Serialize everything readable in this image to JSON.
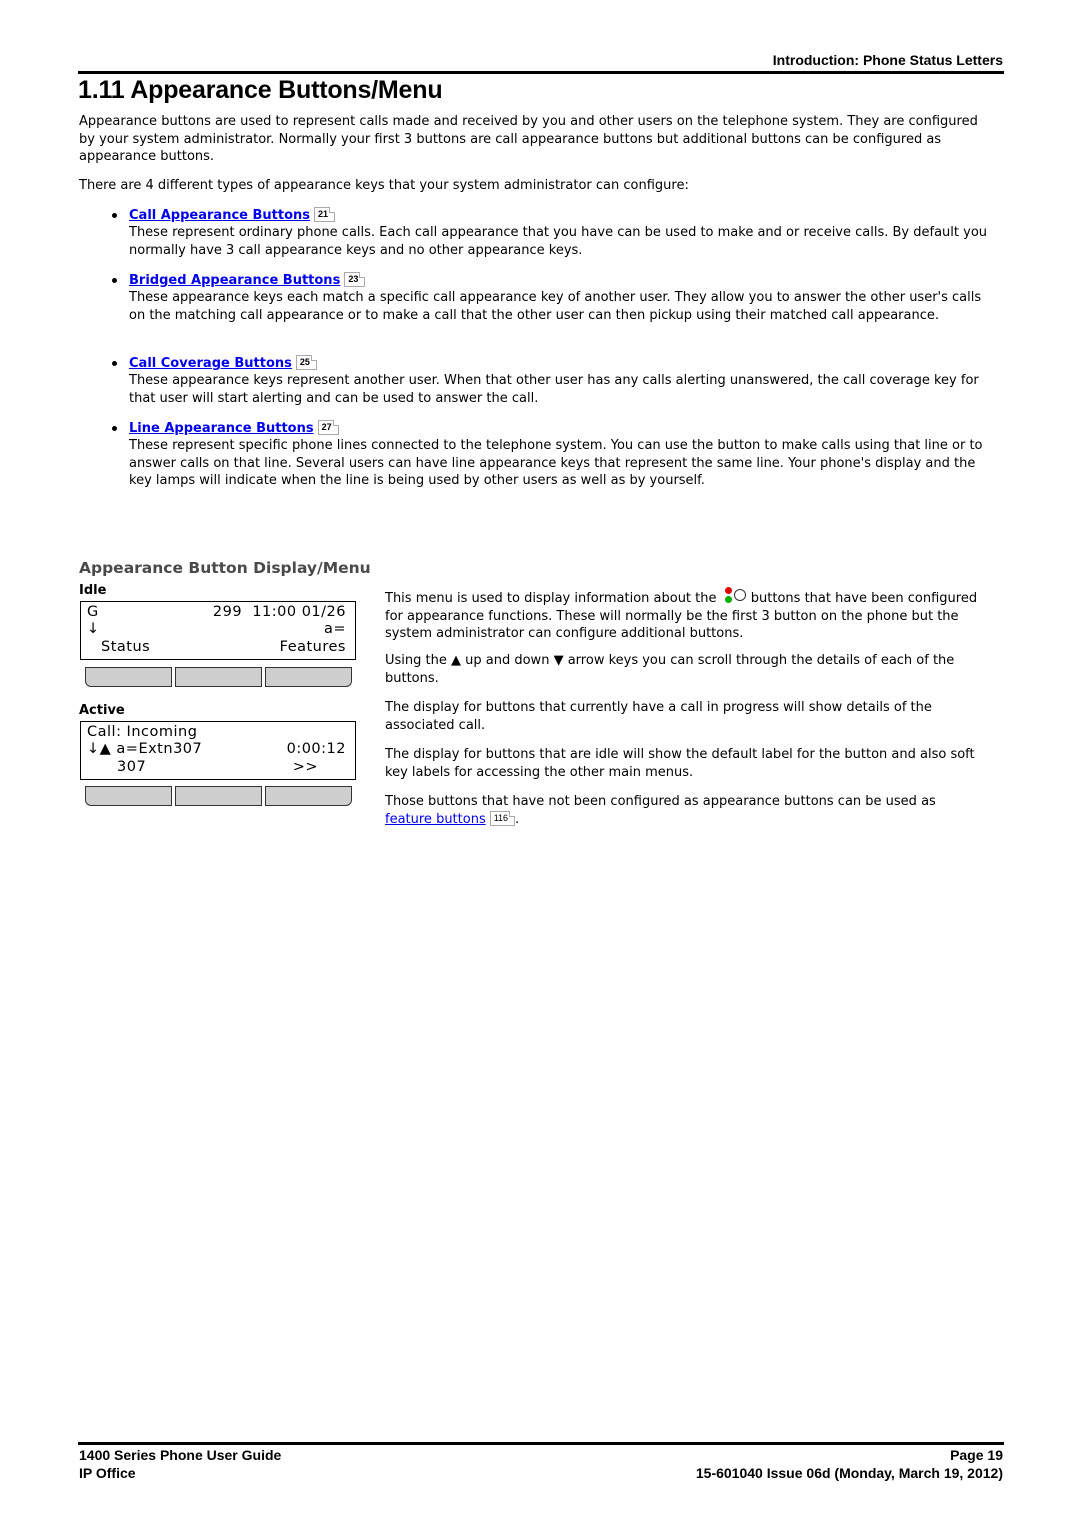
{
  "header": {
    "section": "Introduction: Phone Status Letters",
    "title": "1.11 Appearance Buttons/Menu"
  },
  "intro": {
    "p1": "Appearance buttons are used to represent calls made and received by you and other users on the telephone system. They are configured by your system administrator. Normally your first 3 buttons are call appearance buttons but additional buttons can be configured as appearance buttons.",
    "p2": "There are 4 different types of appearance keys that your system administrator can configure:"
  },
  "types": [
    {
      "label": "Call Appearance Buttons",
      "page_ref": "21",
      "description": "These represent ordinary phone calls. Each call appearance that you have can be used to make and or receive calls. By default you normally have 3 call appearance keys and no other appearance keys."
    },
    {
      "label": "Bridged Appearance Buttons",
      "page_ref": "23",
      "description": "These appearance keys each match a specific call appearance key of another user. They allow you to answer the other user's calls on the matching call appearance or to make a call that the other user can then pickup using their matched call appearance."
    },
    {
      "label": "Call Coverage Buttons",
      "page_ref": "25",
      "description": "These appearance keys represent another user. When that other user has any calls alerting unanswered, the call coverage key for that user will start alerting and can be used to answer the call."
    },
    {
      "label": "Line Appearance Buttons",
      "page_ref": "27",
      "description": "These represent specific phone lines connected to the telephone system. You can use the button to make calls using that line or to answer calls on that line. Several users can have line appearance keys that represent the same line. Your phone's display and the key lamps will indicate when the line is being used by other users as well as by yourself."
    }
  ],
  "display_section": {
    "heading": "Appearance Button Display/Menu",
    "idle": {
      "label": "Idle",
      "row1_left": "G",
      "row1_right": "299  11:00 01/26",
      "row2_left": "↓",
      "row2_right": "a=",
      "row3_left": "Status",
      "row3_right": "Features"
    },
    "active": {
      "label": "Active",
      "row1_left": "Call: Incoming",
      "row2_left": "↓▲ a=Extn307",
      "row2_right": "0:00:12",
      "row3_left": "307",
      "row3_right": ">>"
    },
    "text": {
      "p1_before": "This menu is used to display information about the",
      "p1_icon": "appearance-lamp-icon",
      "p1_after": "buttons that have been configured for appearance functions. These will normally be the first 3 button on the phone but the system administrator can configure additional buttons.",
      "p2_a": "Using the",
      "up_arrow": "▲",
      "p2_b": "up and down",
      "down_arrow": "▼",
      "p2_c": "arrow keys you can scroll through the details of each of the buttons.",
      "p3": "The display for buttons that currently have a call in progress will show details of the associated call.",
      "p4": "The display for buttons that are idle will show the default label for the button and also soft key labels for accessing the other main menus.",
      "p5_before": "Those buttons that have not been configured as appearance buttons can be used as",
      "p5_link": "feature buttons",
      "p5_page_ref": "116",
      "p5_after": "."
    }
  },
  "footer": {
    "guide": "1400 Series Phone User Guide",
    "product": "IP Office",
    "page": "Page 19",
    "issue": "15-601040 Issue 06d (Monday, March 19, 2012)"
  },
  "colors": {
    "link": "#0000ee",
    "subheading": "#4a4a4a",
    "lamp_red": "#e00000",
    "lamp_green": "#00b000"
  }
}
